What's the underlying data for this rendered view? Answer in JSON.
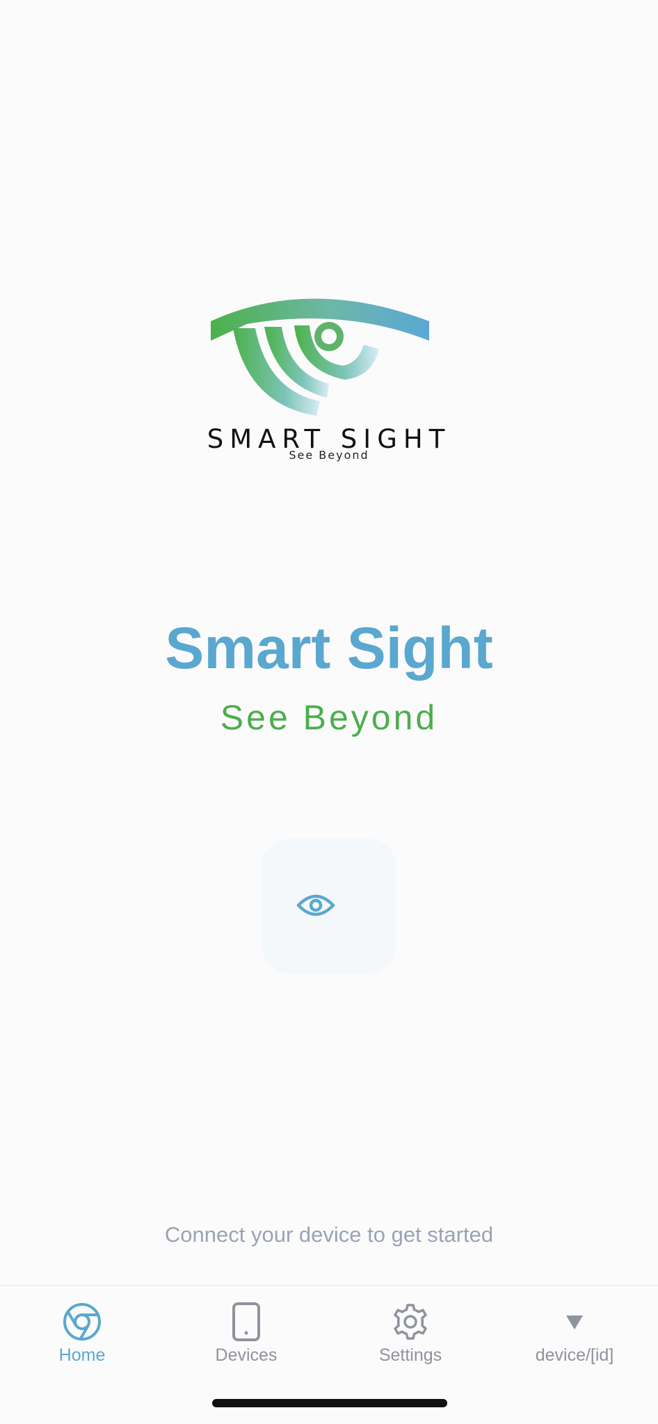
{
  "logo": {
    "wordmark": "SMART SIGHT",
    "tagline": "See Beyond"
  },
  "main": {
    "title": "Smart Sight",
    "subtitle": "See Beyond",
    "hint": "Connect your device to get started"
  },
  "tabs": [
    {
      "label": "Home",
      "icon": "home-icon",
      "active": true
    },
    {
      "label": "Devices",
      "icon": "phone-icon",
      "active": false
    },
    {
      "label": "Settings",
      "icon": "gear-icon",
      "active": false
    },
    {
      "label": "device/[id]",
      "icon": "triangle-down-icon",
      "active": false
    }
  ],
  "colors": {
    "accent_blue": "#5aa7cf",
    "accent_green": "#4cae4c",
    "hint_gray": "#9aa3b5",
    "inactive_gray": "#8e939c"
  }
}
